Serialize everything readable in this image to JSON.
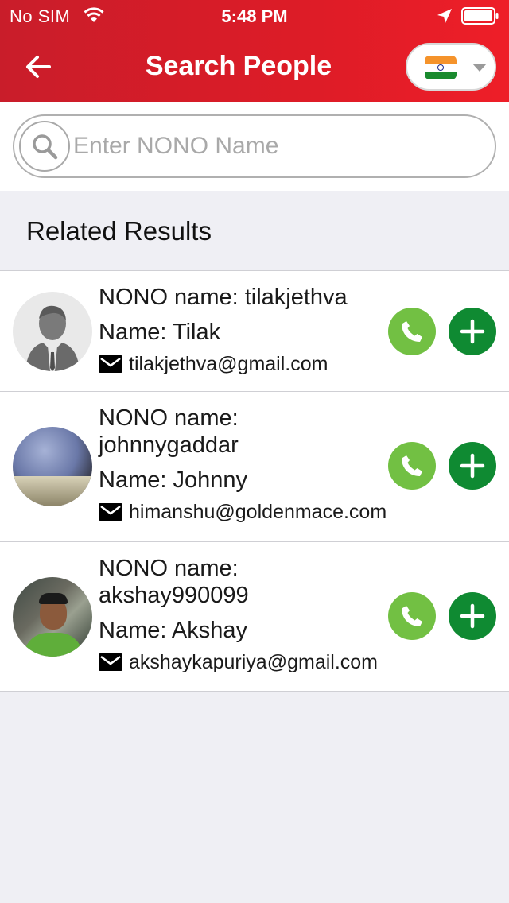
{
  "status_bar": {
    "carrier": "No SIM",
    "time": "5:48 PM"
  },
  "header": {
    "title": "Search People",
    "country_flag": "india-flag-icon"
  },
  "search": {
    "placeholder": "Enter NONO Name",
    "value": ""
  },
  "section": {
    "title": "Related Results"
  },
  "results": [
    {
      "nono_label": "NONO name: tilakjethva",
      "nono_line2": "",
      "name": "Name: Tilak",
      "email": "tilakjethva@gmail.com",
      "avatar": "default-user-icon"
    },
    {
      "nono_label": "NONO name:",
      "nono_line2": "johnnygaddar",
      "name": "Name: Johnny",
      "email": "himanshu@goldenmace.com",
      "avatar": "sky-photo"
    },
    {
      "nono_label": "NONO name:",
      "nono_line2": "akshay990099",
      "name": "Name: Akshay",
      "email": "akshaykapuriya@gmail.com",
      "avatar": "person-photo"
    }
  ],
  "colors": {
    "header_red": "#dd1c27",
    "call_green": "#72c043",
    "add_green": "#0f8a32",
    "background": "#efeff4"
  }
}
